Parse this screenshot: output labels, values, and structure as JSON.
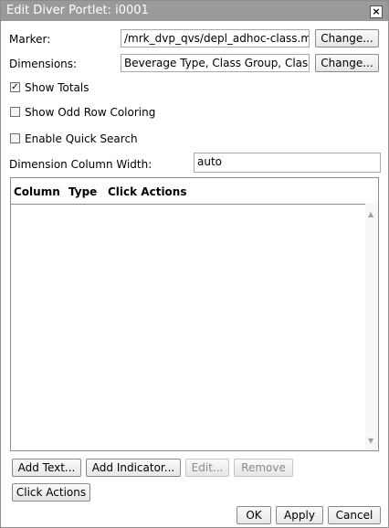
{
  "dialog": {
    "title": "Edit Diver Portlet: i0001",
    "close_glyph": "×"
  },
  "marker": {
    "label": "Marker:",
    "value": "/mrk_dvp_qvs/depl_adhoc-class.mrk",
    "change_label": "Change..."
  },
  "dimensions": {
    "label": "Dimensions:",
    "value": "Beverage Type, Class Group, Class",
    "change_label": "Change..."
  },
  "options": {
    "show_totals": {
      "label": "Show Totals",
      "checked": true
    },
    "odd_row_coloring": {
      "label": "Show Odd Row Coloring",
      "checked": false
    },
    "quick_search": {
      "label": "Enable Quick Search",
      "checked": false
    }
  },
  "dim_col_width": {
    "label": "Dimension Column Width:",
    "value": "auto"
  },
  "grid": {
    "columns": [
      "Column",
      "Type",
      "Click Actions"
    ],
    "rows": []
  },
  "buttons": {
    "add_text": "Add Text...",
    "add_indicator": "Add Indicator...",
    "edit": "Edit...",
    "remove": "Remove",
    "click_actions": "Click Actions",
    "ok": "OK",
    "apply": "Apply",
    "cancel": "Cancel"
  },
  "icons": {
    "close": "close-icon",
    "check": "check-icon",
    "scroll_up": "scroll-up-arrow-icon",
    "scroll_down": "scroll-down-arrow-icon"
  }
}
